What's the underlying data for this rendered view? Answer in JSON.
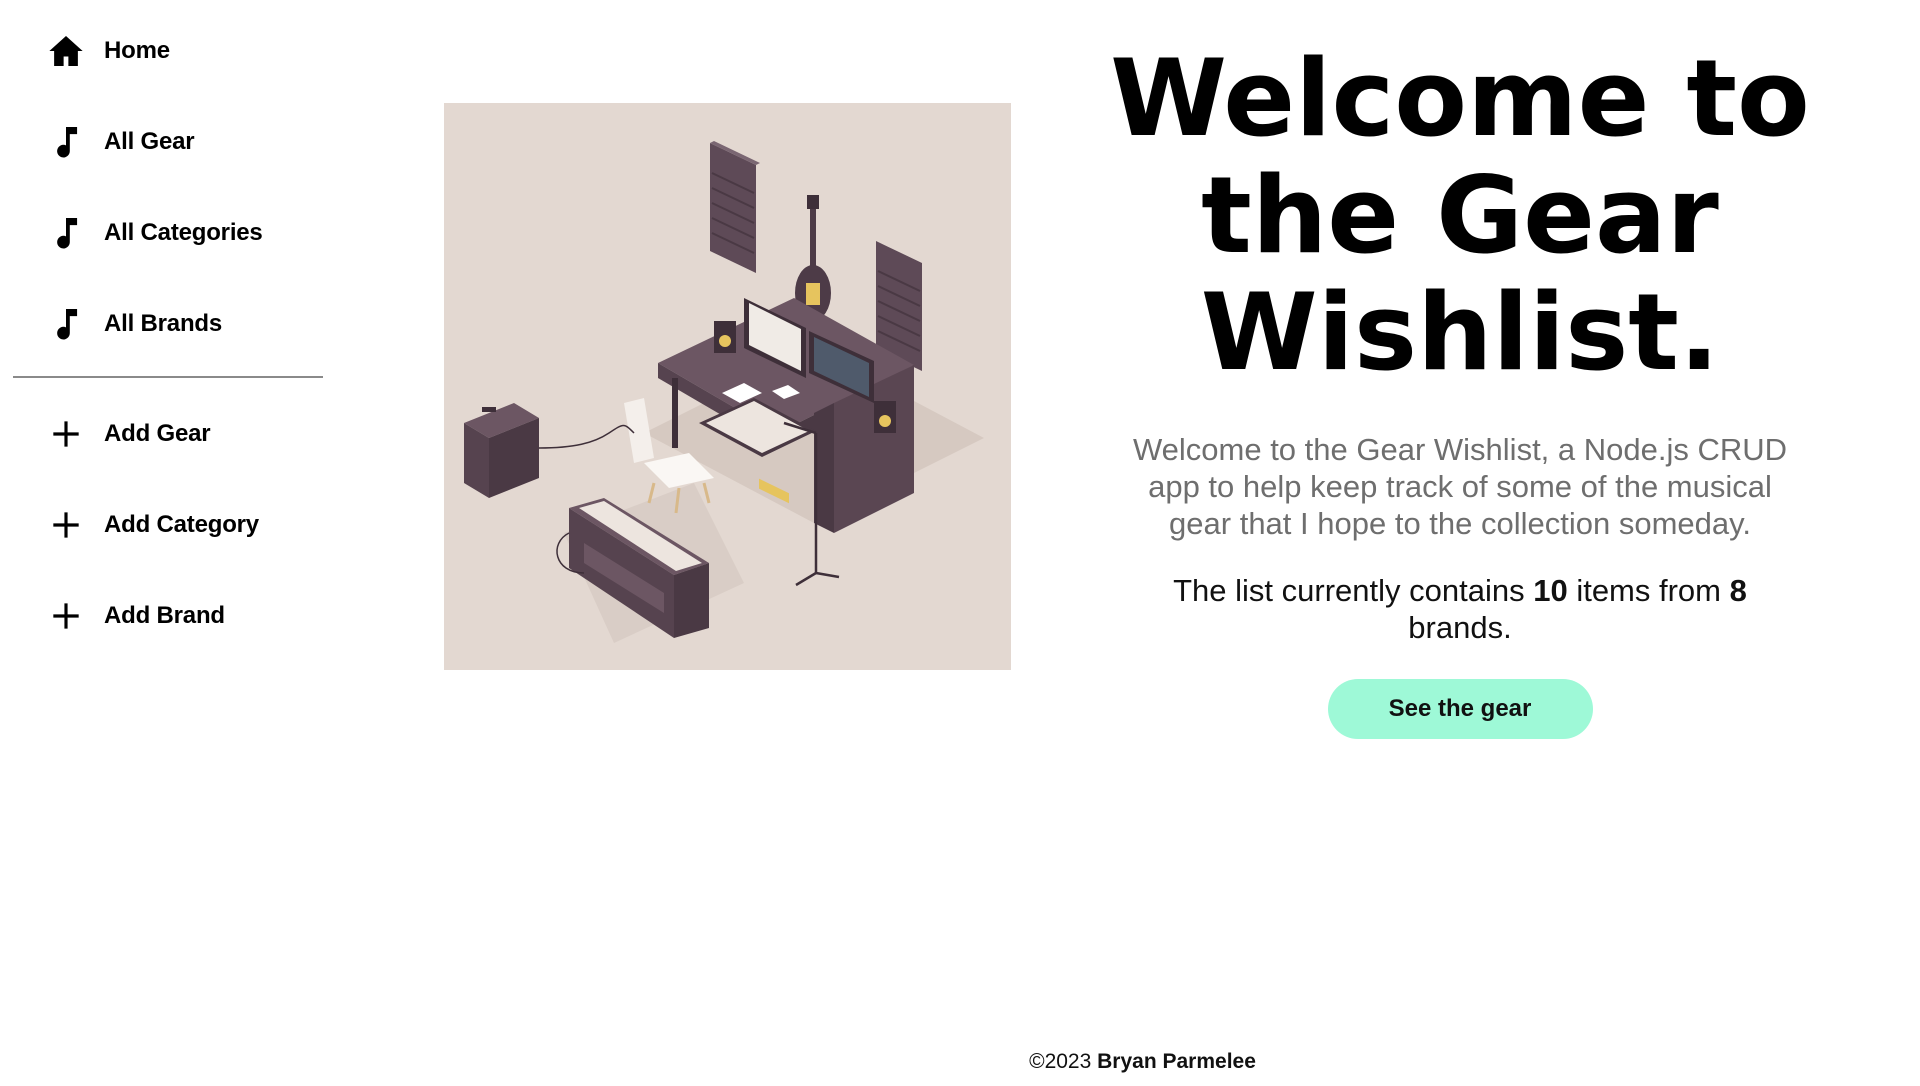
{
  "sidebar": {
    "items": [
      {
        "label": "Home",
        "icon": "home-icon"
      },
      {
        "label": "All Gear",
        "icon": "music-note-icon"
      },
      {
        "label": "All Categories",
        "icon": "music-note-icon"
      },
      {
        "label": "All Brands",
        "icon": "music-note-icon"
      }
    ],
    "actions": [
      {
        "label": "Add Gear",
        "icon": "plus-icon"
      },
      {
        "label": "Add Category",
        "icon": "plus-icon"
      },
      {
        "label": "Add Brand",
        "icon": "plus-icon"
      }
    ]
  },
  "hero": {
    "title_line1": "Welcome to",
    "title_line2": "the Gear",
    "title_line3": "Wishlist.",
    "intro": "Welcome to the Gear Wishlist, a Node.js CRUD app to help keep track of some of the musical gear that I hope to the collection someday.",
    "count_prefix": "The list currently contains ",
    "item_count": "10",
    "count_middle": " items from ",
    "brand_count": "8",
    "count_suffix": " brands.",
    "cta_label": "See the gear"
  },
  "footer": {
    "copyright": "©2023 ",
    "author": "Bryan Parmelee"
  },
  "colors": {
    "cta_background": "#9ef9d7",
    "image_background": "#e3d8d1",
    "intro_text": "#6e6e6e"
  }
}
